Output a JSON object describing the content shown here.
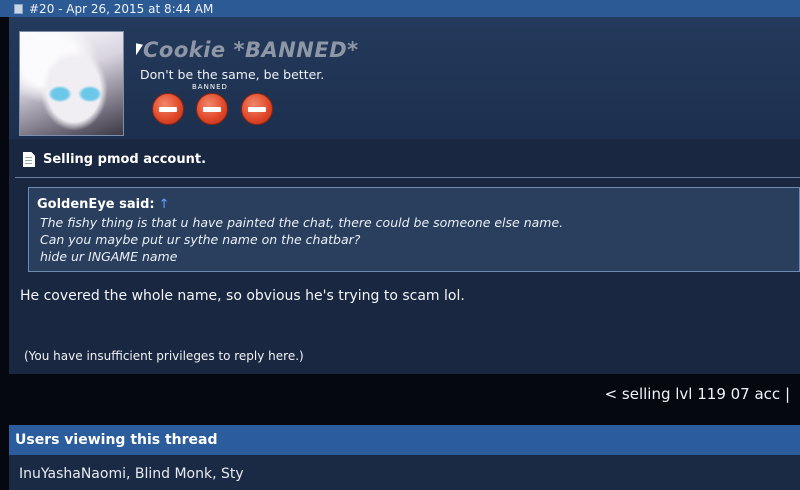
{
  "post": {
    "meta": "#20 - Apr 26, 2015 at 8:44 AM",
    "author": {
      "name": "Cookie *BANNED*",
      "title": "Don't be the same, be better.",
      "badge_label": "BANNED"
    },
    "thread_title": "Selling pmod account.",
    "quote": {
      "author": "GoldenEye said:",
      "arrow": "↑",
      "lines": [
        "The fishy thing is that u have painted the chat, there could be someone else name.",
        "Can you maybe put ur sythe name on the chatbar?",
        "hide ur INGAME name"
      ]
    },
    "message": "He covered the whole name, so obvious he's trying to scam lol.",
    "reply_notice": "(You have insufficient privileges to reply here.)"
  },
  "navigation": {
    "next_thread": "< selling lvl 119 07 acc |"
  },
  "viewers": {
    "heading": "Users viewing this thread",
    "list": "InuYashaNaomi, Blind Monk, Sty"
  }
}
